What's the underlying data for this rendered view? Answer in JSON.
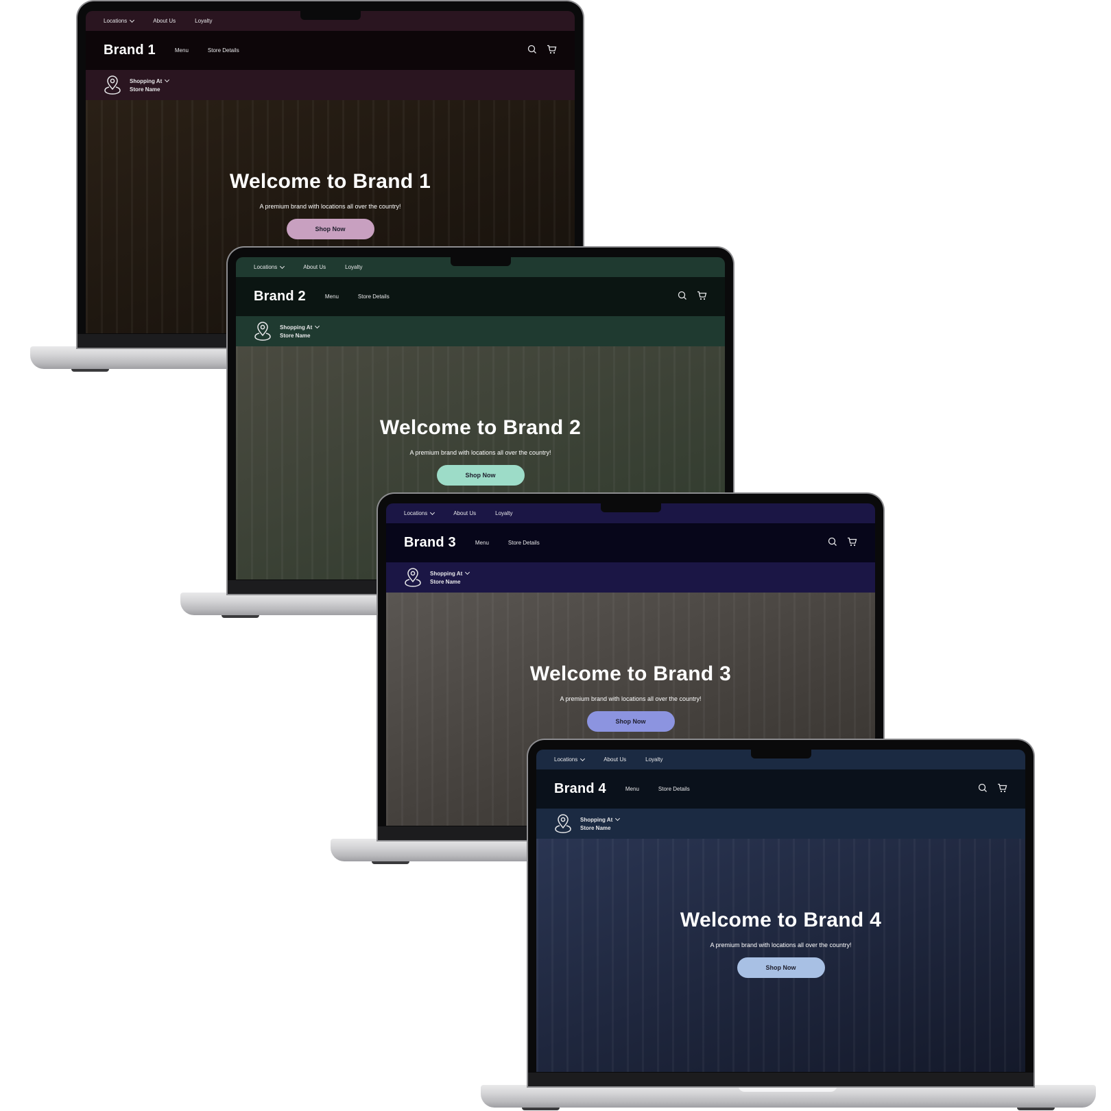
{
  "common": {
    "topbar": {
      "locations": "Locations",
      "about": "About Us",
      "loyalty": "Loyalty"
    },
    "nav": {
      "menu": "Menu",
      "store_details": "Store Details"
    },
    "store": {
      "shopping_at": "Shopping At",
      "store_name": "Store Name"
    },
    "hero": {
      "subtitle": "A premium brand with locations all over the country!",
      "button": "Shop Now"
    },
    "icons": {
      "search": "search-icon",
      "cart": "cart-icon",
      "pin": "map-pin-icon",
      "chevron": "chevron-down-icon"
    }
  },
  "laptops": [
    {
      "brand": "Brand 1",
      "hero_title": "Welcome to Brand 1",
      "colors": {
        "topbar": "#2a1520",
        "nav": "#0d0609",
        "storebar": "#2a1520",
        "button": "#c8a0c0",
        "hero_a": "#2a2016",
        "hero_b": "#15100b"
      }
    },
    {
      "brand": "Brand 2",
      "hero_title": "Welcome to Brand 2",
      "colors": {
        "topbar": "#1f3a30",
        "nav": "#0b1512",
        "storebar": "#1f3a30",
        "button": "#9ddcc8",
        "hero_a": "#4a4a40",
        "hero_b": "#2e3a2c"
      }
    },
    {
      "brand": "Brand 3",
      "hero_title": "Welcome to Brand 3",
      "colors": {
        "topbar": "#1b1645",
        "nav": "#07061a",
        "storebar": "#1b1645",
        "button": "#8c94e0",
        "hero_a": "#5a5652",
        "hero_b": "#34302c"
      }
    },
    {
      "brand": "Brand 4",
      "hero_title": "Welcome to Brand 4",
      "colors": {
        "topbar": "#1b2a42",
        "nav": "#0a111b",
        "storebar": "#1b2a42",
        "button": "#a8c0e4",
        "hero_a": "#2a3552",
        "hero_b": "#14192a"
      }
    }
  ]
}
